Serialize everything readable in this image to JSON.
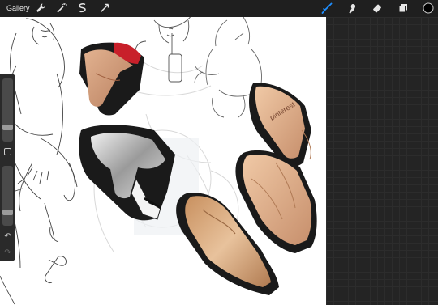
{
  "toolbar": {
    "gallery_label": "Gallery",
    "left_tools": [
      "wrench-icon",
      "magic-wand-icon",
      "selection-icon",
      "transform-icon"
    ],
    "right_tools": [
      "brush-icon",
      "smudge-icon",
      "eraser-icon",
      "layers-icon",
      "color-swatch"
    ],
    "active_tool": "brush-icon",
    "active_color": "#1f8fff",
    "current_color": "#000000"
  },
  "sidebar": {
    "brush_size_level": 0.2,
    "opacity_level": 0.2,
    "undo_icon": "undo-icon",
    "redo_icon": "redo-icon"
  },
  "canvas": {
    "watermark": "pinterest"
  }
}
